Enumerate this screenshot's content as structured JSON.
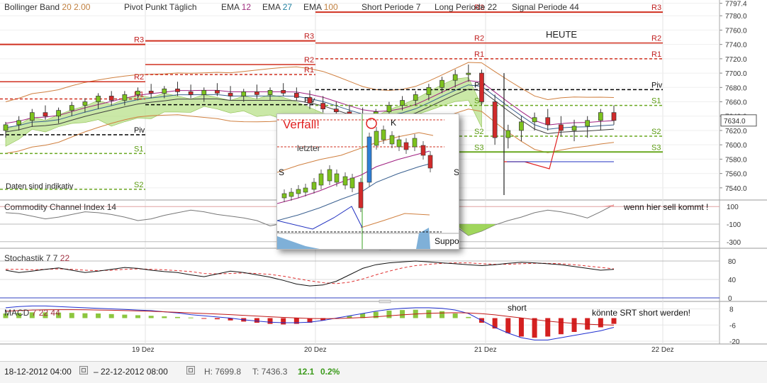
{
  "header": {
    "bollinger_label": "Bollinger Band",
    "bollinger_period": "20",
    "bollinger_dev": "2.00",
    "pivot_label": "Pivot Punkt Täglich",
    "ema1_label": "EMA",
    "ema1_value": "12",
    "ema2_label": "EMA",
    "ema2_value": "27",
    "ema3_label": "EMA",
    "ema3_value": "100",
    "short_label": "Short Periode",
    "short_value": "7",
    "long_label": "Long Periode",
    "long_value": "22",
    "signal_label": "Signal Periode",
    "signal_value": "44"
  },
  "colors": {
    "bull": "#7dc21e",
    "bear": "#d12a2a",
    "resistance": "#d03020",
    "support": "#6aa820",
    "pivot": "#000000",
    "bollinger": "#d08040",
    "cloud": "#b8e08a"
  },
  "annotations": {
    "heute": "HEUTE",
    "daten": "Daten sind indikativ",
    "verfall": "Verfall!",
    "letzter": "letzter",
    "k": "K",
    "s_left": "S",
    "s_right": "S",
    "suppo": "Suppo",
    "cci_note": "wenn hier sell kommt !",
    "macd_short": "short",
    "macd_note": "könnte SRT short werden!"
  },
  "price_levels": {
    "day1": [
      {
        "label": "R3",
        "kind": "r"
      },
      {
        "label": "R2",
        "kind": "r"
      },
      {
        "label": "R1",
        "kind": "r"
      },
      {
        "label": "Piv",
        "kind": "p"
      },
      {
        "label": "S1",
        "kind": "s"
      },
      {
        "label": "S2",
        "kind": "s"
      }
    ],
    "day2": [
      {
        "label": "R3",
        "kind": "r"
      },
      {
        "label": "R2",
        "kind": "r"
      },
      {
        "label": "R1",
        "kind": "r"
      },
      {
        "label": "Piv",
        "kind": "p"
      }
    ],
    "day3": [
      {
        "label": "R3",
        "kind": "r"
      },
      {
        "label": "R2",
        "kind": "r"
      },
      {
        "label": "R1",
        "kind": "r"
      },
      {
        "label": "Piv",
        "kind": "p"
      },
      {
        "label": "S1",
        "kind": "s"
      },
      {
        "label": "S2",
        "kind": "s"
      },
      {
        "label": "S3",
        "kind": "s"
      }
    ],
    "day4": [
      {
        "label": "R3",
        "kind": "r"
      },
      {
        "label": "R2",
        "kind": "r"
      },
      {
        "label": "R1",
        "kind": "r"
      },
      {
        "label": "Piv",
        "kind": "p"
      },
      {
        "label": "S1",
        "kind": "s"
      },
      {
        "label": "S2",
        "kind": "s"
      },
      {
        "label": "S3",
        "kind": "s"
      }
    ]
  },
  "chart_data": [
    {
      "type": "candlestick",
      "title": "",
      "ylim": [
        7525,
        7800
      ],
      "y_ticks": [
        "7797.4",
        "7780.0",
        "7760.0",
        "7740.0",
        "7720.0",
        "7700.0",
        "7680.0",
        "7660.0",
        "7640.0",
        "7620.0",
        "7600.0",
        "7580.0",
        "7560.0",
        "7540.0"
      ],
      "last_price": "7634.0",
      "x_ticks": [
        "19 Dez",
        "20 Dez",
        "21 Dez",
        "22 Dez"
      ],
      "pivot_levels": {
        "19 Dez": {
          "R3": 7740,
          "R2": 7688,
          "R1": 7664,
          "Piv": 7614,
          "S1": 7588,
          "S2": 7538
        },
        "20 Dez": {
          "R3": 7745,
          "R2": 7712,
          "R1": 7698,
          "Piv": 7656
        },
        "21 Dez": {
          "R3": 7785,
          "R2": 7742,
          "R1": 7720,
          "Piv": 7677,
          "S1": 7655,
          "S2": 7612,
          "S3": 7590
        }
      },
      "candles": [
        [
          7620,
          7632,
          7610,
          7628
        ],
        [
          7628,
          7640,
          7620,
          7634
        ],
        [
          7634,
          7650,
          7625,
          7645
        ],
        [
          7645,
          7655,
          7635,
          7640
        ],
        [
          7640,
          7652,
          7630,
          7648
        ],
        [
          7648,
          7660,
          7640,
          7655
        ],
        [
          7655,
          7665,
          7645,
          7660
        ],
        [
          7660,
          7672,
          7650,
          7668
        ],
        [
          7668,
          7675,
          7655,
          7662
        ],
        [
          7662,
          7675,
          7655,
          7670
        ],
        [
          7670,
          7680,
          7662,
          7675
        ],
        [
          7675,
          7685,
          7665,
          7672
        ],
        [
          7672,
          7682,
          7665,
          7678
        ],
        [
          7678,
          7688,
          7668,
          7674
        ],
        [
          7674,
          7684,
          7665,
          7670
        ],
        [
          7670,
          7680,
          7660,
          7676
        ],
        [
          7676,
          7686,
          7668,
          7672
        ],
        [
          7672,
          7682,
          7662,
          7668
        ],
        [
          7668,
          7678,
          7660,
          7674
        ],
        [
          7674,
          7684,
          7664,
          7670
        ],
        [
          7670,
          7680,
          7662,
          7676
        ],
        [
          7676,
          7686,
          7668,
          7672
        ],
        [
          7672,
          7680,
          7662,
          7666
        ],
        [
          7666,
          7676,
          7650,
          7658
        ],
        [
          7658,
          7668,
          7645,
          7650
        ],
        [
          7650,
          7660,
          7640,
          7646
        ],
        [
          7646,
          7656,
          7636,
          7642
        ],
        [
          7642,
          7652,
          7632,
          7638
        ],
        [
          7638,
          7650,
          7630,
          7646
        ],
        [
          7646,
          7660,
          7640,
          7655
        ],
        [
          7655,
          7668,
          7648,
          7662
        ],
        [
          7662,
          7675,
          7655,
          7670
        ],
        [
          7670,
          7685,
          7662,
          7680
        ],
        [
          7680,
          7695,
          7672,
          7690
        ],
        [
          7690,
          7705,
          7680,
          7698
        ],
        [
          7698,
          7712,
          7688,
          7700
        ],
        [
          7700,
          7705,
          7655,
          7660
        ],
        [
          7660,
          7670,
          7600,
          7610
        ],
        [
          7610,
          7628,
          7595,
          7620
        ],
        [
          7620,
          7640,
          7605,
          7632
        ],
        [
          7632,
          7645,
          7620,
          7638
        ],
        [
          7638,
          7650,
          7620,
          7628
        ],
        [
          7628,
          7640,
          7612,
          7620
        ],
        [
          7620,
          7635,
          7605,
          7626
        ],
        [
          7626,
          7640,
          7610,
          7634
        ],
        [
          7634,
          7650,
          7620,
          7645
        ],
        [
          7645,
          7655,
          7628,
          7634
        ]
      ]
    },
    {
      "type": "line",
      "title": "Commodity Channel Index",
      "period": "14",
      "ylim": [
        -350,
        150
      ],
      "y_ticks": [
        "100",
        "-100",
        "-300"
      ],
      "values": [
        30,
        20,
        -10,
        -40,
        -20,
        10,
        40,
        30,
        10,
        -20,
        -60,
        -40,
        0,
        30,
        60,
        40,
        10,
        -10,
        -30,
        -60,
        -120,
        -90,
        -30,
        20,
        60,
        40,
        0,
        -30,
        -10,
        40,
        90,
        60,
        20,
        -40,
        -120,
        -230,
        -180,
        -110,
        -60,
        -20,
        30,
        60,
        40,
        10,
        -30,
        40,
        120
      ]
    },
    {
      "type": "line",
      "title": "Stochastik",
      "params": [
        "7",
        "7",
        "22"
      ],
      "ylim": [
        0,
        100
      ],
      "y_ticks": [
        "80",
        "40",
        "0"
      ],
      "k_values": [
        60,
        55,
        58,
        62,
        65,
        60,
        55,
        58,
        62,
        66,
        64,
        60,
        57,
        55,
        50,
        46,
        52,
        58,
        55,
        50,
        45,
        38,
        30,
        26,
        28,
        36,
        50,
        64,
        72,
        76,
        78,
        80,
        78,
        76,
        74,
        72,
        70,
        72,
        75,
        77,
        76,
        74,
        72,
        68,
        64,
        60,
        62
      ],
      "d_values": [
        62,
        62,
        61,
        62,
        63,
        62,
        60,
        59,
        60,
        62,
        63,
        62,
        61,
        59,
        57,
        53,
        52,
        53,
        54,
        53,
        51,
        47,
        42,
        37,
        33,
        31,
        34,
        41,
        50,
        58,
        65,
        70,
        73,
        75,
        76,
        76,
        74,
        73,
        73,
        74,
        75,
        75,
        74,
        72,
        69,
        66,
        63
      ]
    },
    {
      "type": "bar",
      "title": "MACD",
      "params": [
        "7",
        "22",
        "44"
      ],
      "ylim": [
        -20,
        12
      ],
      "y_ticks": [
        "8",
        "-6",
        "-20"
      ],
      "histogram": [
        4,
        4.5,
        5,
        5,
        4.8,
        4.5,
        4.2,
        4,
        3.5,
        3,
        2.5,
        2,
        1.5,
        1,
        0.5,
        -0.5,
        -1,
        -2,
        -3,
        -4,
        -5,
        -5.5,
        -5,
        -4,
        -2,
        0,
        2,
        4,
        5.5,
        6.5,
        7,
        7.2,
        7,
        6,
        4,
        1,
        -4,
        -9,
        -13,
        -16,
        -17,
        -16,
        -14,
        -12,
        -10,
        -8,
        -5
      ],
      "macd": [
        9,
        10,
        10.5,
        10.5,
        10,
        9.5,
        9,
        8.5,
        8,
        7.5,
        7,
        6.5,
        5.5,
        4.5,
        3,
        2,
        1,
        0,
        -1.5,
        -2.5,
        -3.5,
        -4,
        -4,
        -3.5,
        -2,
        0,
        2,
        4,
        6,
        7.5,
        8.5,
        9,
        9,
        8.5,
        7,
        4,
        -2,
        -8,
        -13,
        -17,
        -19,
        -19,
        -17,
        -15,
        -13,
        -11,
        -8
      ],
      "signal": [
        6,
        6.5,
        7,
        7.2,
        7.3,
        7.3,
        7.2,
        7,
        6.8,
        6.5,
        6.2,
        5.9,
        5.5,
        5,
        4.5,
        4,
        3.5,
        3,
        2.4,
        1.8,
        1.2,
        0.6,
        0.1,
        -0.3,
        -0.5,
        -0.4,
        0,
        0.5,
        1.2,
        2,
        2.8,
        3.5,
        4.1,
        4.5,
        4.7,
        4.5,
        3.8,
        2.8,
        1.5,
        0.1,
        -1.3,
        -2.6,
        -3.7,
        -4.6,
        -5.3,
        -5.8,
        -6.1
      ]
    }
  ],
  "status": {
    "date_from": "18-12-2012 04:00",
    "date_to": "22-12-2012 08:00",
    "high": "H: 7699.8",
    "low": "T: 7436.3",
    "change": "12.1",
    "change_pct": "0.2%"
  }
}
